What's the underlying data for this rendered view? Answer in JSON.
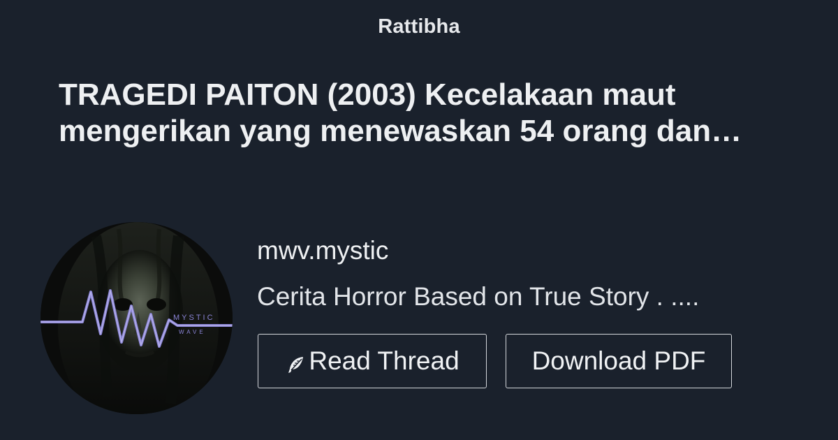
{
  "brand": {
    "name": "Rattibha"
  },
  "thread": {
    "title": "TRAGEDI PAITON (2003) Kecelakaan maut mengerikan yang menewaskan 54 orang dan…"
  },
  "author": {
    "handle": "mwv.mystic",
    "bio": "Cerita Horror Based on True Story . ....",
    "avatar_text_top": "MYSTIC",
    "avatar_text_bottom": "WAVE"
  },
  "actions": {
    "read_label": "Read Thread",
    "read_icon": "feather-icon",
    "pdf_label": "Download PDF"
  },
  "colors": {
    "background": "#1a212c",
    "text": "#eef0f2",
    "button_border": "#d5d8dc",
    "avatar_wave": "#8a84d6"
  }
}
